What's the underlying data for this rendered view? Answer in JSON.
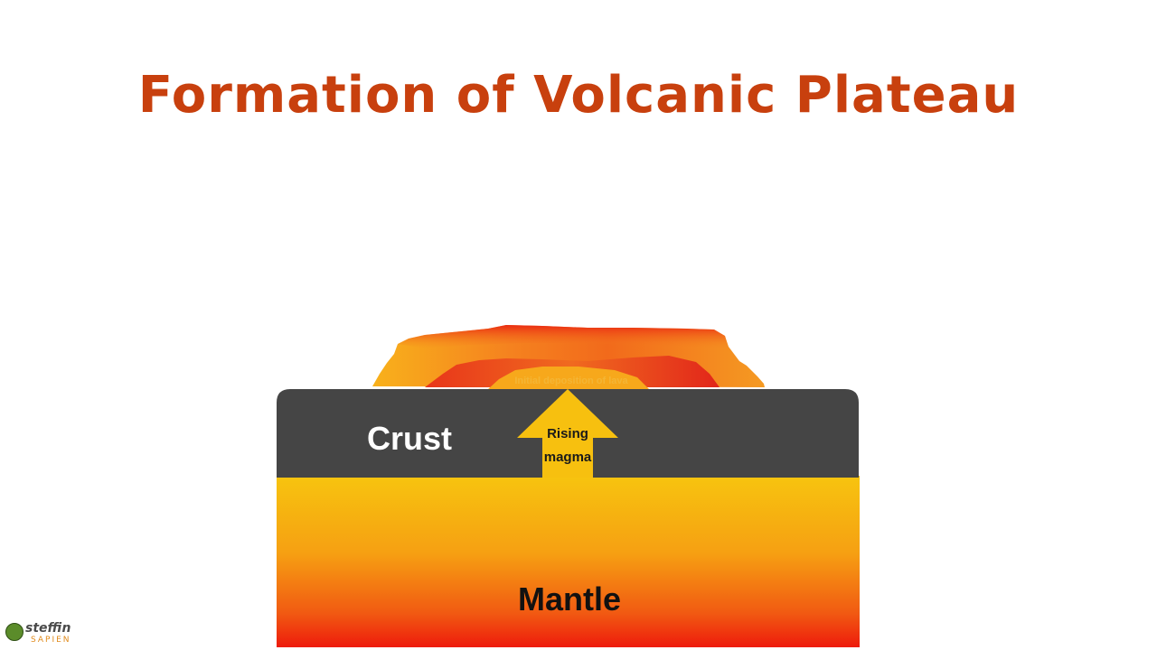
{
  "title": "Formation of Volcanic Plateau",
  "labels": {
    "crust": "Crust",
    "rising_magma_line1": "Rising",
    "rising_magma_line2": "magma",
    "mantle": "Mantle",
    "initial_deposition": "Initial deposition of lava"
  },
  "logo": {
    "name": "steffin",
    "sub": "SAPIEN"
  },
  "colors": {
    "title": "#c8400e",
    "crust": "#454545",
    "mantle_top": "#f7c40f",
    "mantle_bottom": "#ee1b0c",
    "arrow": "#f7c00f",
    "lava_orange": "#f5821f",
    "lava_red": "#ea2a12"
  }
}
